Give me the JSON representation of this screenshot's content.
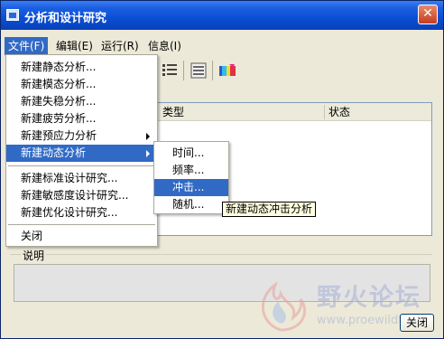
{
  "window": {
    "title": "分析和设计研究",
    "close_symbol": "✕"
  },
  "menubar": [
    {
      "label": "文件(F)"
    },
    {
      "label": "编辑(E)"
    },
    {
      "label": "运行(R)"
    },
    {
      "label": "信息(I)"
    }
  ],
  "file_menu": {
    "group1": [
      {
        "label": "新建静态分析..."
      },
      {
        "label": "新建模态分析..."
      },
      {
        "label": "新建失稳分析..."
      },
      {
        "label": "新建疲劳分析..."
      },
      {
        "label": "新建预应力分析"
      },
      {
        "label": "新建动态分析"
      }
    ],
    "group2": [
      {
        "label": "新建标准设计研究..."
      },
      {
        "label": "新建敏感度设计研究..."
      },
      {
        "label": "新建优化设计研究..."
      }
    ],
    "close": "关闭"
  },
  "dynamic_submenu": [
    {
      "label": "时间..."
    },
    {
      "label": "频率..."
    },
    {
      "label": "冲击..."
    },
    {
      "label": "随机..."
    }
  ],
  "tooltip": "新建动态冲击分析",
  "table": {
    "columns": [
      "类型",
      "状态"
    ]
  },
  "description": {
    "label": "说明"
  },
  "buttons": {
    "close": "关闭"
  },
  "watermark": {
    "text": "野火论坛",
    "url": "www.proewildfi"
  },
  "colors": {
    "titlebar": "#0a4ed4",
    "highlight": "#316ac5",
    "window_bg": "#ece9d8"
  }
}
